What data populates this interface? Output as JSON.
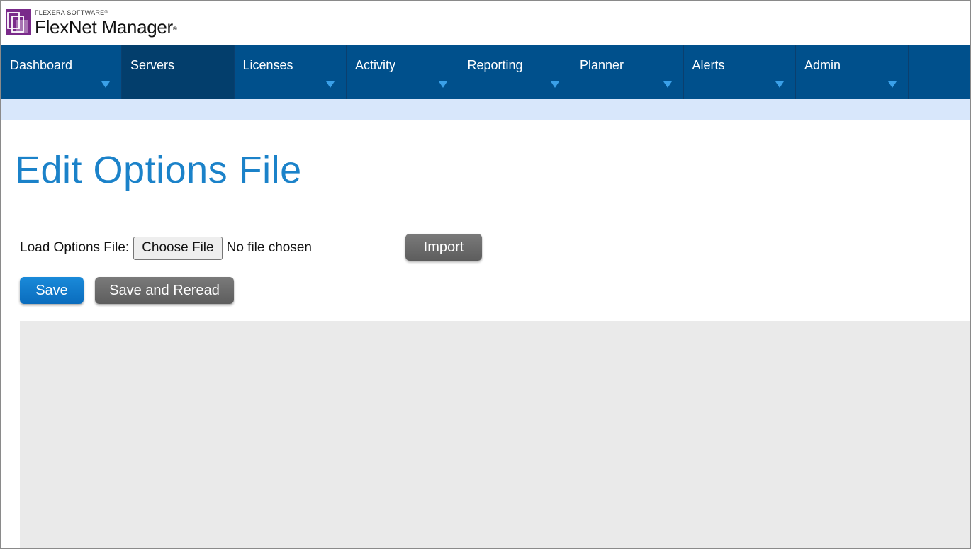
{
  "header": {
    "company": "FLEXERA SOFTWARE",
    "company_mark": "®",
    "product": "FlexNet Manager",
    "product_mark": "®",
    "logo_color": "#7a2a8a"
  },
  "nav": {
    "items": [
      {
        "label": "Dashboard",
        "has_menu": true,
        "active": false
      },
      {
        "label": "Servers",
        "has_menu": false,
        "active": true
      },
      {
        "label": "Licenses",
        "has_menu": true,
        "active": false
      },
      {
        "label": "Activity",
        "has_menu": true,
        "active": false
      },
      {
        "label": "Reporting",
        "has_menu": true,
        "active": false
      },
      {
        "label": "Planner",
        "has_menu": true,
        "active": false
      },
      {
        "label": "Alerts",
        "has_menu": true,
        "active": false
      },
      {
        "label": "Admin",
        "has_menu": true,
        "active": false
      }
    ],
    "background": "#00508c",
    "active_background": "#033e6c",
    "arrow_color": "#3aa0e8"
  },
  "page": {
    "title": "Edit Options File",
    "title_color": "#1b82c9"
  },
  "load": {
    "label": "Load Options File:",
    "choose_file_label": "Choose File",
    "no_file_text": "No file chosen",
    "import_label": "Import"
  },
  "actions": {
    "save_label": "Save",
    "save_reread_label": "Save and Reread",
    "save_color": "#0a7ad0",
    "secondary_color": "#666666"
  },
  "editor": {
    "content": ""
  }
}
